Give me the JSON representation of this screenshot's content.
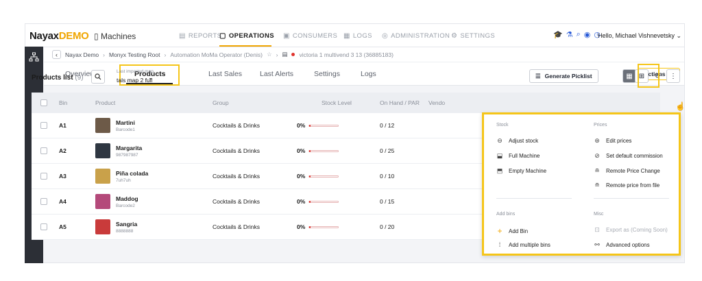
{
  "brand": {
    "name": "Nayax",
    "suffix": "DEMO",
    "section_icon": "machine-icon",
    "section": "Machines"
  },
  "nav": {
    "items": [
      {
        "label": "REPORTS",
        "icon": "report-icon"
      },
      {
        "label": "OPERATIONS",
        "icon": "operations-icon",
        "active": true
      },
      {
        "label": "CONSUMERS",
        "icon": "consumers-icon"
      },
      {
        "label": "LOGS",
        "icon": "logs-icon"
      },
      {
        "label": "ADMINISTRATION",
        "icon": "admin-icon"
      },
      {
        "label": "SETTINGS",
        "icon": "settings-icon"
      }
    ],
    "greeting": "Hello, Michael Vishnevetsky"
  },
  "breadcrumb": {
    "items": [
      "Nayax Demo",
      "Monyx Testing Root",
      "Automation MoMa Operator (Denis)"
    ],
    "machine": "victoria 1 multivend 3 13 (36885183)"
  },
  "tabs": [
    "Overview",
    "Products",
    "Last Sales",
    "Last Alerts",
    "Settings",
    "Logs"
  ],
  "actions_label": "Actions",
  "list": {
    "title": "Products list",
    "count": "(9)",
    "map_label": "Last imported map",
    "map_value": "tals map 2 full",
    "generate_label": "Generate Picklist"
  },
  "table": {
    "headers": [
      "Bin",
      "Product",
      "Group",
      "Stock Level",
      "On Hand / PAR",
      "Vendo"
    ],
    "rows": [
      {
        "bin": "A1",
        "name": "Martini",
        "code": "Barcode1",
        "group": "Cocktails & Drinks",
        "stock": "0%",
        "stock_pct": 0.05,
        "onhand": "0 / 12",
        "thumb": "#6d5a48"
      },
      {
        "bin": "A2",
        "name": "Margarita",
        "code": "987987987",
        "group": "Cocktails & Drinks",
        "stock": "0%",
        "stock_pct": 0.05,
        "onhand": "0 / 25",
        "thumb": "#2f3742"
      },
      {
        "bin": "A3",
        "name": "Piña colada",
        "code": "7uh7uh",
        "group": "Cocktails & Drinks",
        "stock": "0%",
        "stock_pct": 0.05,
        "onhand": "0 / 10",
        "thumb": "#c9a14a"
      },
      {
        "bin": "A4",
        "name": "Maddog",
        "code": "Barcode2",
        "group": "Cocktails & Drinks",
        "stock": "0%",
        "stock_pct": 0.05,
        "onhand": "0 / 15",
        "thumb": "#b4497a"
      },
      {
        "bin": "A5",
        "name": "Sangria",
        "code": "8888888",
        "group": "Cocktails & Drinks",
        "stock": "0%",
        "stock_pct": 0.05,
        "onhand": "0 / 20",
        "thumb": "#c93b3b"
      }
    ]
  },
  "menu": {
    "stock_header": "Stock",
    "prices_header": "Prices",
    "add_bins_header": "Add bins",
    "misc_header": "Misc",
    "stock_items": [
      "Adjust stock",
      "Full Machine",
      "Empty Machine"
    ],
    "price_items": [
      "Edit prices",
      "Set default commission",
      "Remote Price Change",
      "Remote price from file"
    ],
    "add_items": [
      "Add Bin",
      "Add multiple bins"
    ],
    "misc_items": [
      "Export as (Coming Soon)",
      "Advanced options"
    ]
  },
  "colors": {
    "accent": "#f0a500",
    "highlight": "#f5c518",
    "alert": "#e0332d",
    "link": "#2a5bd7"
  }
}
